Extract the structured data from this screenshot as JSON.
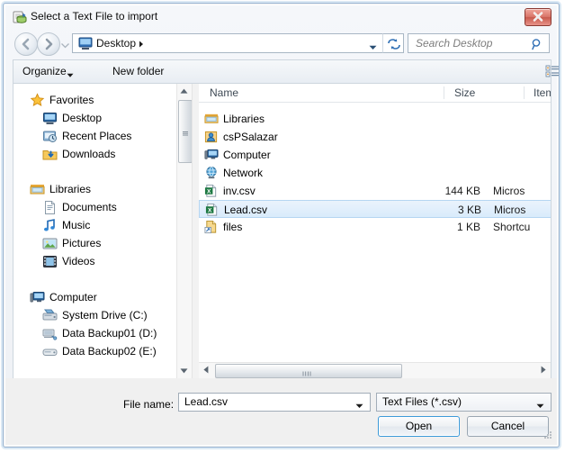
{
  "window": {
    "title": "Select a Text File to import",
    "title_icon": "import-text-file-icon",
    "close_label": "Close"
  },
  "address_bar": {
    "back_icon": "back-arrow-icon",
    "forward_icon": "forward-arrow-icon",
    "recent_icon": "recent-locations-icon",
    "location_icon": "desktop-icon",
    "crumb": "Desktop",
    "crumb_separator": "▸",
    "dropdown_icon": "chevron-down-icon",
    "refresh_icon": "refresh-icon",
    "search_placeholder": "Search Desktop",
    "search_value": "",
    "search_icon": "search-icon"
  },
  "toolbar": {
    "organize_label": "Organize",
    "organize_arrow_icon": "chevron-down-icon",
    "new_folder_label": "New folder",
    "view_icon": "view-list-icon",
    "view_arrow_icon": "chevron-down-icon",
    "preview_pane_icon": "preview-pane-icon",
    "help_icon": "help-icon"
  },
  "navigation_pane": {
    "groups": [
      {
        "label": "Favorites",
        "icon": "star-icon",
        "items": [
          {
            "label": "Desktop",
            "icon": "desktop-icon"
          },
          {
            "label": "Recent Places",
            "icon": "recent-places-icon"
          },
          {
            "label": "Downloads",
            "icon": "downloads-folder-icon"
          }
        ]
      },
      {
        "label": "Libraries",
        "icon": "libraries-icon",
        "items": [
          {
            "label": "Documents",
            "icon": "documents-library-icon"
          },
          {
            "label": "Music",
            "icon": "music-library-icon"
          },
          {
            "label": "Pictures",
            "icon": "pictures-library-icon"
          },
          {
            "label": "Videos",
            "icon": "videos-library-icon"
          }
        ]
      },
      {
        "label": "Computer",
        "icon": "computer-icon",
        "items": [
          {
            "label": "System Drive (C:)",
            "icon": "system-drive-icon"
          },
          {
            "label": "Data Backup01 (D:)",
            "icon": "network-drive-icon"
          },
          {
            "label": "Data Backup02 (E:)",
            "icon": "hard-drive-icon"
          }
        ]
      }
    ],
    "scroll_up_icon": "scroll-up-arrow-icon",
    "scroll_down_icon": "scroll-down-arrow-icon"
  },
  "file_list": {
    "columns": [
      {
        "label": "Name"
      },
      {
        "label": "Size"
      },
      {
        "label": "Item ty"
      }
    ],
    "rows": [
      {
        "name": "Libraries",
        "size": "",
        "type": "",
        "icon": "libraries-icon",
        "selected": false
      },
      {
        "name": "csPSalazar",
        "size": "",
        "type": "",
        "icon": "user-folder-icon",
        "selected": false
      },
      {
        "name": "Computer",
        "size": "",
        "type": "",
        "icon": "computer-icon",
        "selected": false
      },
      {
        "name": "Network",
        "size": "",
        "type": "",
        "icon": "network-icon",
        "selected": false
      },
      {
        "name": "inv.csv",
        "size": "144 KB",
        "type": "Micros",
        "icon": "csv-file-icon",
        "selected": false
      },
      {
        "name": "Lead.csv",
        "size": "3 KB",
        "type": "Micros",
        "icon": "csv-file-icon",
        "selected": true
      },
      {
        "name": "files",
        "size": "1 KB",
        "type": "Shortcu",
        "icon": "shortcut-file-icon",
        "selected": false
      }
    ],
    "hscroll_left_icon": "scroll-left-arrow-icon",
    "hscroll_right_icon": "scroll-right-arrow-icon"
  },
  "footer": {
    "file_name_label": "File name:",
    "file_name_value": "Lead.csv",
    "file_name_placeholder": "",
    "file_name_arrow_icon": "chevron-down-icon",
    "file_type_value": "Text Files (*.csv)",
    "file_type_arrow_icon": "chevron-down-icon",
    "open_label": "Open",
    "cancel_label": "Cancel",
    "resize_grip_icon": "resize-grip-icon"
  },
  "colors": {
    "selection": "#d9ebfb",
    "selection_border": "#b6d6f2",
    "accent_button_border": "#3c9ad9",
    "close_button": "#c85b4d",
    "window_border": "#9ab6d4"
  }
}
